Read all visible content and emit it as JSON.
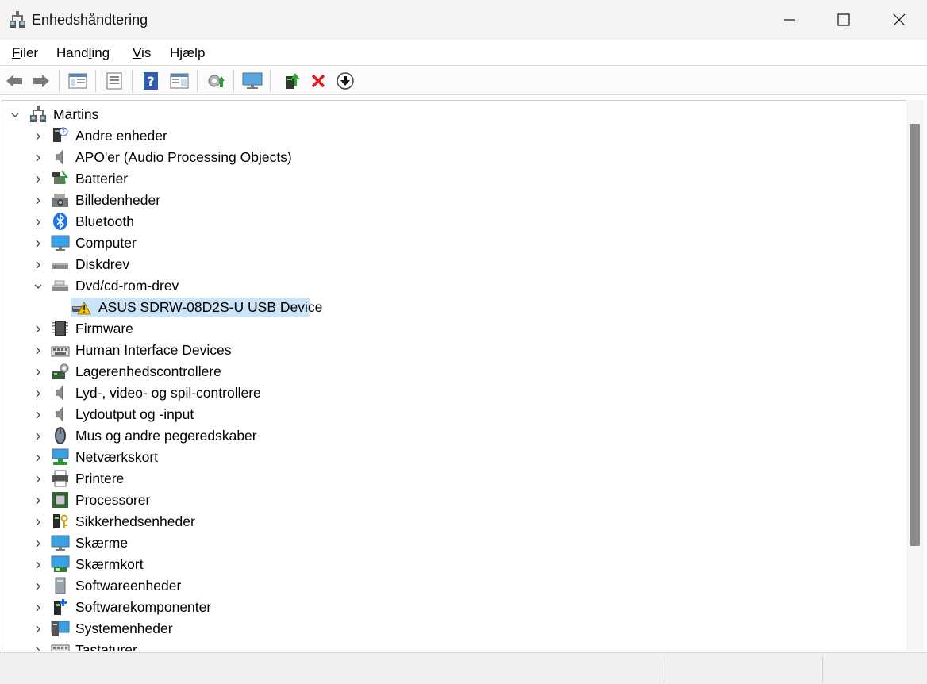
{
  "window": {
    "title": "Enhedshåndtering"
  },
  "menu": [
    {
      "label_pre": "",
      "label_ul": "F",
      "label_post": "iler"
    },
    {
      "label_pre": "Hand",
      "label_ul": "l",
      "label_post": "ing"
    },
    {
      "label_pre": "",
      "label_ul": "V",
      "label_post": "is"
    },
    {
      "label_pre": "H",
      "label_ul": "j",
      "label_post": "ælp"
    }
  ],
  "toolbar": {
    "buttons": [
      "back-icon",
      "forward-icon",
      "show-hide-console-tree-icon",
      "properties-icon",
      "help-icon",
      "action-pane-icon",
      "scan-hardware-icon",
      "monitor-icon",
      "update-driver-icon",
      "uninstall-icon",
      "disable-device-icon"
    ]
  },
  "tree": {
    "root": "Martins",
    "items": [
      {
        "label": "Andre enheder",
        "icon": "unknown-device-icon"
      },
      {
        "label": "APO'er (Audio Processing Objects)",
        "icon": "speaker-icon"
      },
      {
        "label": "Batterier",
        "icon": "battery-icon"
      },
      {
        "label": "Billedenheder",
        "icon": "camera-icon"
      },
      {
        "label": "Bluetooth",
        "icon": "bluetooth-icon"
      },
      {
        "label": "Computer",
        "icon": "computer-icon"
      },
      {
        "label": "Diskdrev",
        "icon": "disk-drive-icon"
      },
      {
        "label": "Dvd/cd-rom-drev",
        "icon": "dvd-drive-icon",
        "expanded": true
      },
      {
        "label": "Firmware",
        "icon": "firmware-icon"
      },
      {
        "label": "Human Interface Devices",
        "icon": "hid-icon"
      },
      {
        "label": "Lagerenhedscontrollere",
        "icon": "storage-controller-icon"
      },
      {
        "label": "Lyd-, video- og spil-controllere",
        "icon": "speaker-icon"
      },
      {
        "label": "Lydoutput og -input",
        "icon": "speaker-icon"
      },
      {
        "label": "Mus og andre pegeredskaber",
        "icon": "mouse-icon"
      },
      {
        "label": "Netværkskort",
        "icon": "network-adapter-icon"
      },
      {
        "label": "Printere",
        "icon": "printer-icon"
      },
      {
        "label": "Processorer",
        "icon": "processor-icon"
      },
      {
        "label": "Sikkerhedsenheder",
        "icon": "security-device-icon"
      },
      {
        "label": "Skærme",
        "icon": "monitor-icon"
      },
      {
        "label": "Skærmkort",
        "icon": "display-adapter-icon"
      },
      {
        "label": "Softwareenheder",
        "icon": "software-device-icon"
      },
      {
        "label": "Softwarekomponenter",
        "icon": "software-component-icon"
      },
      {
        "label": "Systemenheder",
        "icon": "system-device-icon"
      },
      {
        "label": "Tastaturer",
        "icon": "keyboard-icon"
      }
    ],
    "child": {
      "label": "ASUS SDRW-08D2S-U USB Device",
      "icon": "dvd-warning-icon",
      "parent_index": 7,
      "selected": true
    }
  }
}
